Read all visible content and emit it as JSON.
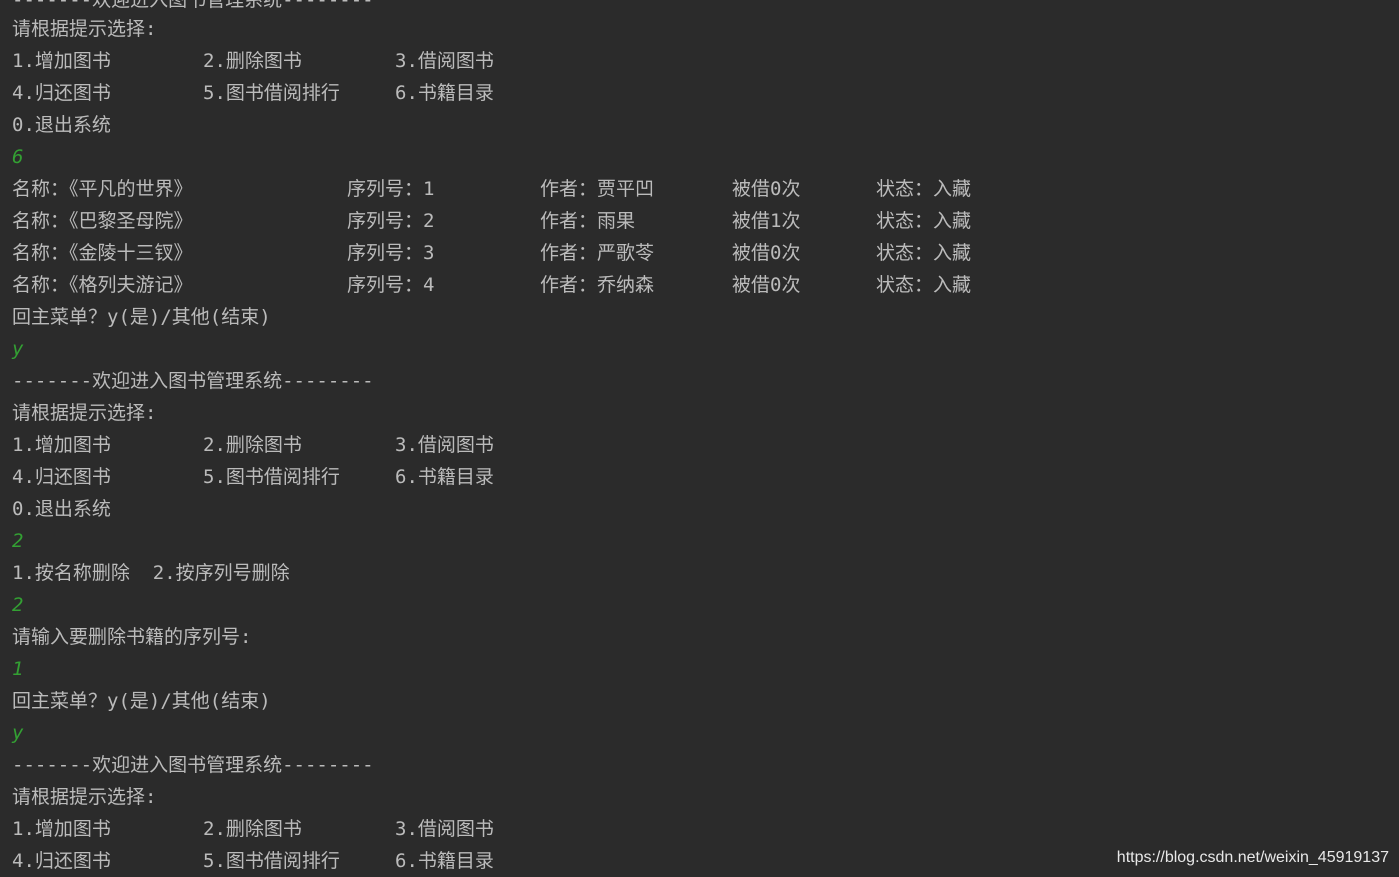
{
  "console": {
    "header_partial": "-------欢迎进入图书管理系统--------",
    "header": "-------欢迎进入图书管理系统--------",
    "prompt_select": "请根据提示选择:",
    "menu": {
      "add": "1.增加图书",
      "delete": "2.删除图书",
      "borrow": "3.借阅图书",
      "return": "4.归还图书",
      "ranking": "5.图书借阅排行",
      "catalog": "6.书籍目录",
      "exit": "0.退出系统"
    },
    "user_inputs": [
      "6",
      "y",
      "2",
      "2",
      "1",
      "y"
    ],
    "books": [
      {
        "name": "名称：《平凡的世界》",
        "id": "序列号：1",
        "author": "作者：贾平凹",
        "borrowed": "被借0次",
        "status": "状态：入藏"
      },
      {
        "name": "名称：《巴黎圣母院》",
        "id": "序列号：2",
        "author": "作者：雨果",
        "borrowed": "被借1次",
        "status": "状态：入藏"
      },
      {
        "name": "名称：《金陵十三钗》",
        "id": "序列号：3",
        "author": "作者：严歌苓",
        "borrowed": "被借0次",
        "status": "状态：入藏"
      },
      {
        "name": "名称：《格列夫游记》",
        "id": "序列号：4",
        "author": "作者：乔纳森",
        "borrowed": "被借0次",
        "status": "状态：入藏"
      }
    ],
    "back_to_menu": "回主菜单？y(是)/其他(结束)",
    "delete_options": "1.按名称删除  2.按序列号删除",
    "delete_prompt": "请输入要删除书籍的序列号:"
  },
  "watermark": "https://blog.csdn.net/weixin_45919137",
  "colors": {
    "background": "#2b2b2b",
    "output_text": "#bbbbbb",
    "user_input": "#33a033"
  }
}
